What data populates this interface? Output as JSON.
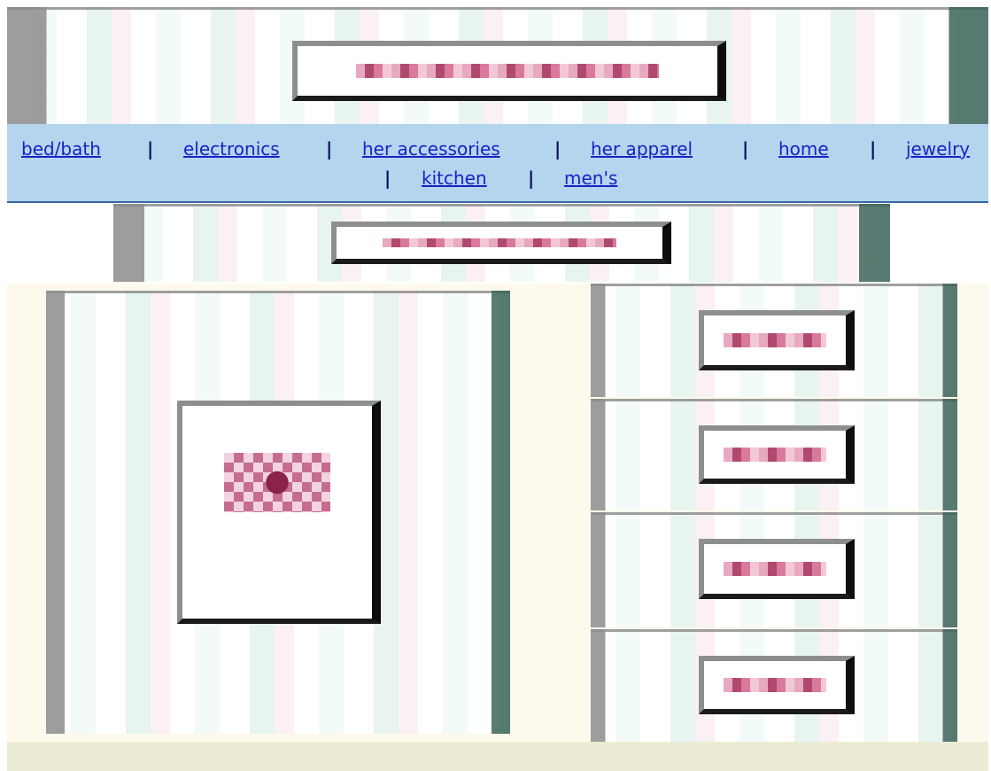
{
  "nav": {
    "links": [
      "bed/bath",
      "electronics",
      "her accessories",
      "her apparel",
      "home",
      "jewelry",
      "kitchen",
      "men's"
    ],
    "separator": "|"
  },
  "images": {
    "header_banner": "broken-image-icon",
    "sub_banner": "broken-image-icon",
    "feature": "broken-image-icon",
    "thumbnails": [
      "broken-image-icon",
      "broken-image-icon",
      "broken-image-icon",
      "broken-image-icon"
    ]
  },
  "colors": {
    "nav_background": "#b3d6ee",
    "link": "#1a22c4",
    "content_background": "#fdf9ec",
    "footer_background": "#ecebd6"
  }
}
